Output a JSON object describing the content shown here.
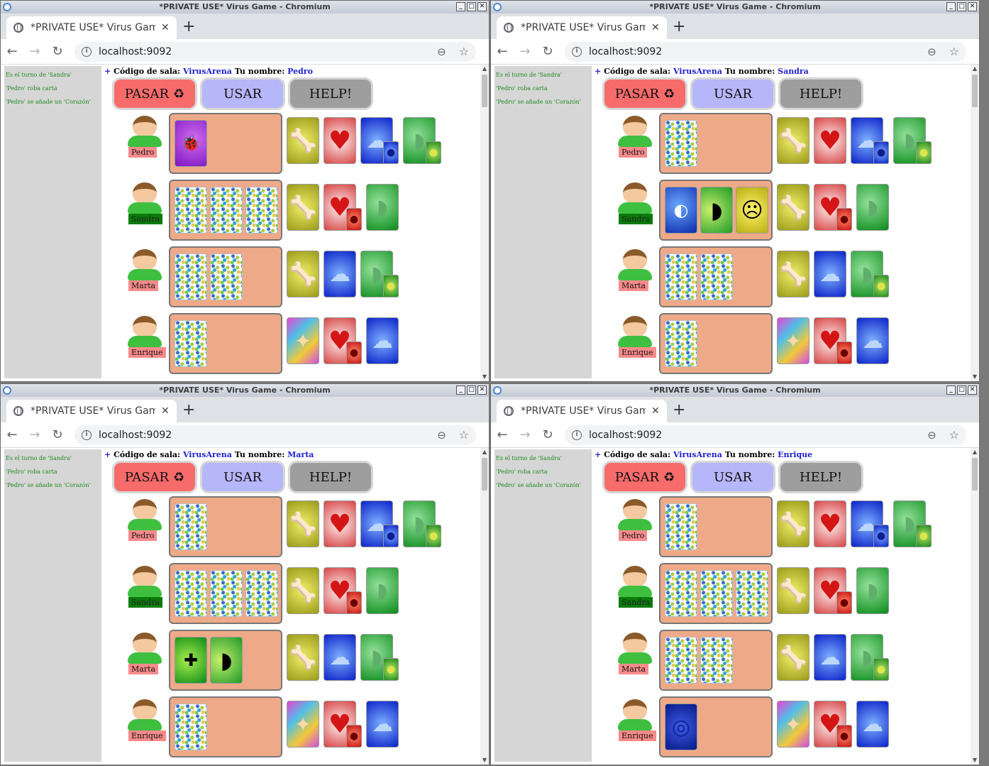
{
  "window_title": "*PRIVATE USE* Virus Game - Chromium",
  "tab_title": "*PRIVATE USE* Virus Game",
  "tab_close": "✕",
  "new_tab": "+",
  "url": "localhost:9092",
  "log": [
    "Es el turno de 'Sandra'",
    "'Pedro' roba carta",
    "'Pedro' se añade un 'Corazón'"
  ],
  "header": {
    "plus": "+",
    "room_label": "Código de sala:",
    "room_code": "VirusArena",
    "name_label": "Tu nombre:"
  },
  "buttons": {
    "pasar": "PASAR",
    "recycle": "♻",
    "usar": "USAR",
    "help": "HELP!"
  },
  "players": [
    "Pedro",
    "Sandra",
    "Marta",
    "Enrique"
  ],
  "active_player": "Sandra",
  "windows": [
    {
      "you": "Pedro",
      "hands": [
        [
          "thief"
        ],
        [
          "back",
          "back",
          "back"
        ],
        [
          "back",
          "back"
        ],
        [
          "back"
        ]
      ]
    },
    {
      "you": "Sandra",
      "hands": [
        [
          "back"
        ],
        [
          "pill",
          "med",
          "germ"
        ],
        [
          "back",
          "back"
        ],
        [
          "back"
        ]
      ]
    },
    {
      "you": "Marta",
      "hands": [
        [
          "back"
        ],
        [
          "back",
          "back",
          "back"
        ],
        [
          "medkit",
          "med"
        ],
        [
          "back"
        ]
      ]
    },
    {
      "you": "Enrique",
      "hands": [
        [
          "back"
        ],
        [
          "back",
          "back",
          "back"
        ],
        [
          "back",
          "back"
        ],
        [
          "spiral"
        ]
      ]
    }
  ],
  "boards": [
    [
      {
        "organ": "bone",
        "mini": null
      },
      {
        "organ": "heart",
        "mini": null
      },
      {
        "organ": "brain",
        "mini": "blue-virus"
      },
      {
        "organ": "stomach",
        "mini": "green-virus"
      }
    ],
    [
      {
        "organ": "bone",
        "mini": null
      },
      {
        "organ": "heart",
        "mini": "red-virus"
      },
      {
        "organ": "stomach",
        "mini": null
      }
    ],
    [
      {
        "organ": "bone",
        "mini": null
      },
      {
        "organ": "brain",
        "mini": null
      },
      {
        "organ": "stomach",
        "mini": "green-virus"
      }
    ],
    [
      {
        "organ": "wildcard",
        "mini": null
      },
      {
        "organ": "heart",
        "mini": "red-virus"
      },
      {
        "organ": "brain",
        "mini": null
      }
    ]
  ],
  "icons": {
    "bone": "🦴",
    "heart": "♥",
    "brain": "☁",
    "stomach": "◗",
    "wildcard": "✦",
    "thief": "🐞",
    "pill": "◐",
    "med": "◗",
    "germ": "☹",
    "medkit": "✚",
    "spiral": "◎",
    "blue-virus": "●",
    "green-virus": "●",
    "red-virus": "●"
  }
}
